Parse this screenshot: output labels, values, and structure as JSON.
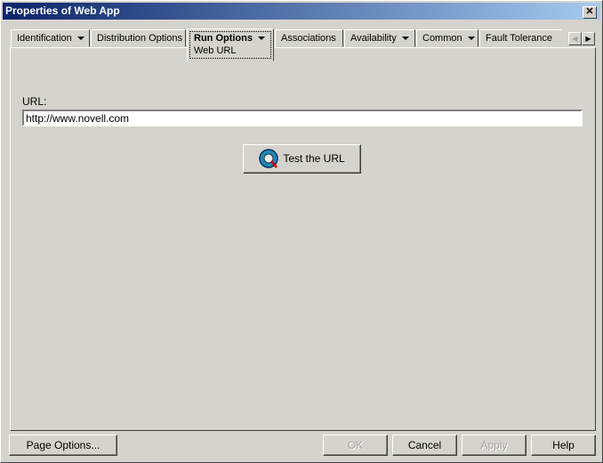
{
  "window": {
    "title": "Properties of Web App",
    "close": "✕"
  },
  "tabs": [
    {
      "label": "Identification",
      "dropdown": true
    },
    {
      "label": "Distribution Options",
      "dropdown": false
    },
    {
      "label": "Run Options",
      "dropdown": true,
      "active": true,
      "subtab": "Web URL"
    },
    {
      "label": "Associations",
      "dropdown": false
    },
    {
      "label": "Availability",
      "dropdown": true
    },
    {
      "label": "Common",
      "dropdown": true
    },
    {
      "label": "Fault Tolerance",
      "dropdown": false
    }
  ],
  "tab_scroll": {
    "left": "◀",
    "right": "▶"
  },
  "form": {
    "url_label": "URL:",
    "url_value": "http://www.novell.com",
    "test_button": "Test the URL"
  },
  "footer": {
    "page_options": "Page Options...",
    "ok": "OK",
    "cancel": "Cancel",
    "apply": "Apply",
    "help": "Help"
  }
}
